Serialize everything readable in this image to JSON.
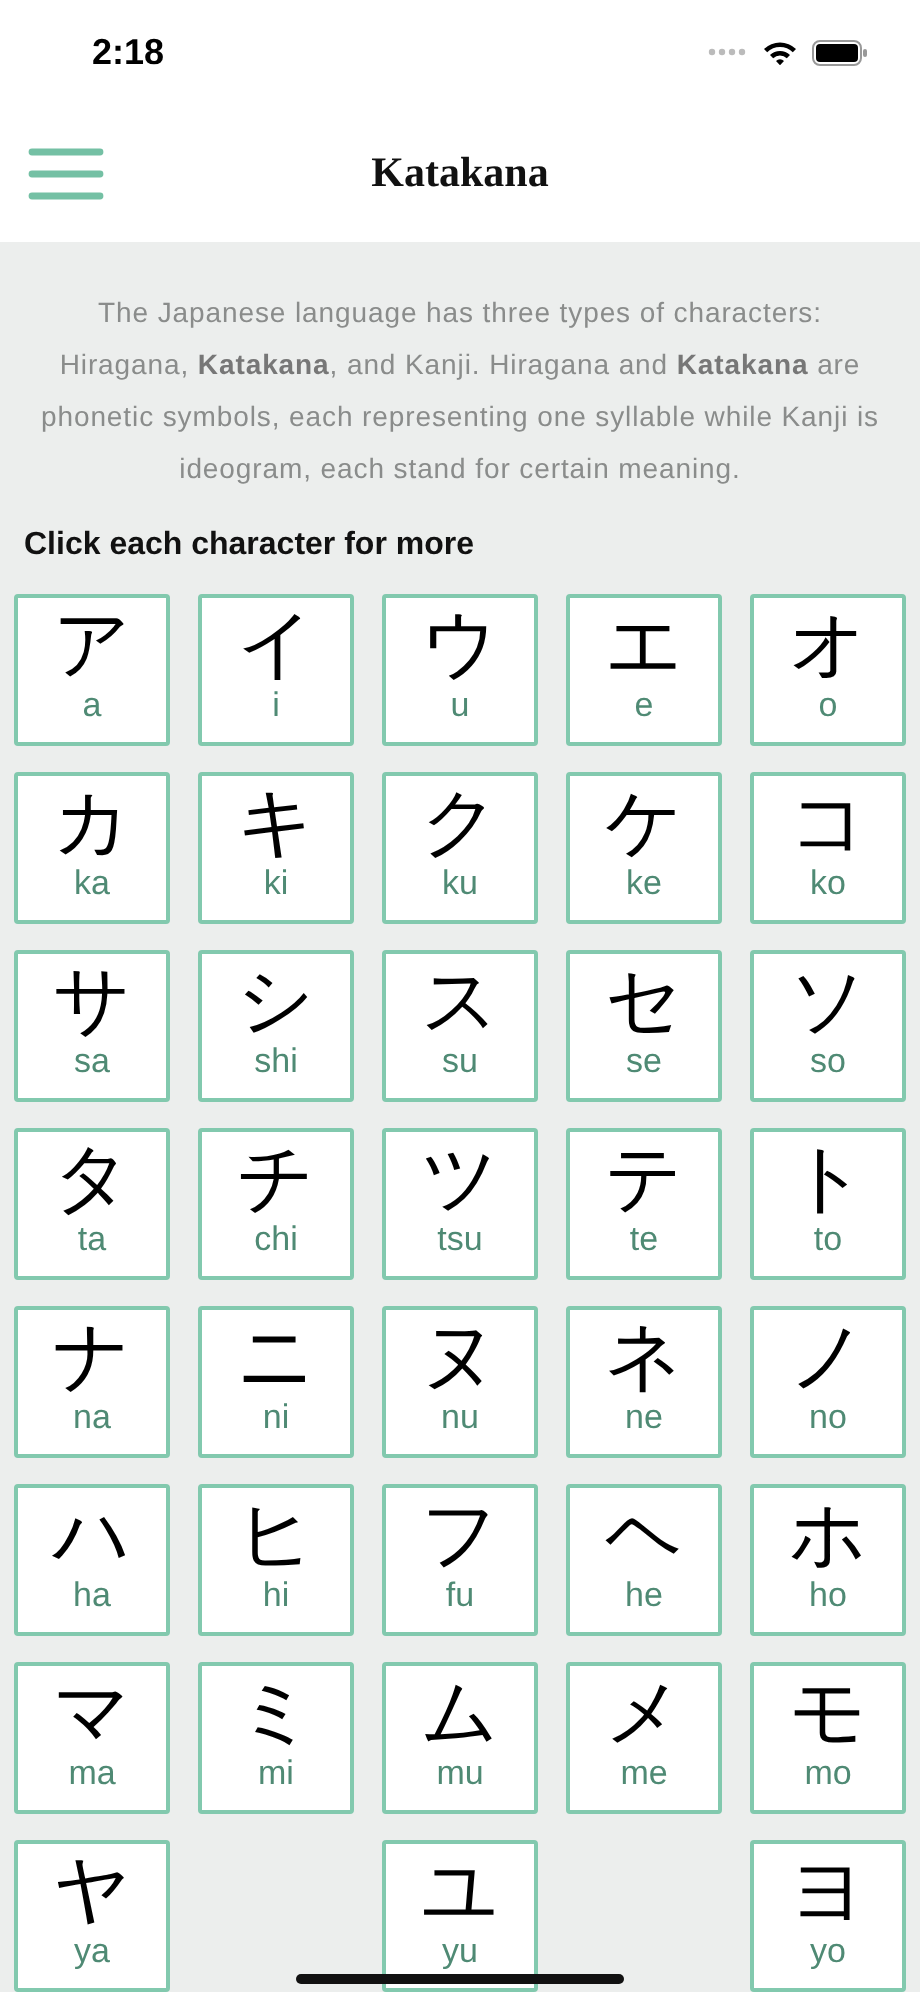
{
  "status_bar": {
    "time": "2:18"
  },
  "header": {
    "title": "Katakana"
  },
  "intro": "The Japanese language has three types of characters: Hiragana, **Katakana**, and Kanji. Hiragana and **Katakana** are phonetic symbols, each representing one syllable while Kanji is ideogram, each stand for certain meaning.",
  "instruction": "Click each character for more",
  "characters": [
    {
      "kind": "char",
      "kana": "ア",
      "romaji": "a"
    },
    {
      "kind": "char",
      "kana": "イ",
      "romaji": "i"
    },
    {
      "kind": "char",
      "kana": "ウ",
      "romaji": "u"
    },
    {
      "kind": "char",
      "kana": "エ",
      "romaji": "e"
    },
    {
      "kind": "char",
      "kana": "オ",
      "romaji": "o"
    },
    {
      "kind": "char",
      "kana": "カ",
      "romaji": "ka"
    },
    {
      "kind": "char",
      "kana": "キ",
      "romaji": "ki"
    },
    {
      "kind": "char",
      "kana": "ク",
      "romaji": "ku"
    },
    {
      "kind": "char",
      "kana": "ケ",
      "romaji": "ke"
    },
    {
      "kind": "char",
      "kana": "コ",
      "romaji": "ko"
    },
    {
      "kind": "char",
      "kana": "サ",
      "romaji": "sa"
    },
    {
      "kind": "char",
      "kana": "シ",
      "romaji": "shi"
    },
    {
      "kind": "char",
      "kana": "ス",
      "romaji": "su"
    },
    {
      "kind": "char",
      "kana": "セ",
      "romaji": "se"
    },
    {
      "kind": "char",
      "kana": "ソ",
      "romaji": "so"
    },
    {
      "kind": "char",
      "kana": "タ",
      "romaji": "ta"
    },
    {
      "kind": "char",
      "kana": "チ",
      "romaji": "chi"
    },
    {
      "kind": "char",
      "kana": "ツ",
      "romaji": "tsu"
    },
    {
      "kind": "char",
      "kana": "テ",
      "romaji": "te"
    },
    {
      "kind": "char",
      "kana": "ト",
      "romaji": "to"
    },
    {
      "kind": "char",
      "kana": "ナ",
      "romaji": "na"
    },
    {
      "kind": "char",
      "kana": "ニ",
      "romaji": "ni"
    },
    {
      "kind": "char",
      "kana": "ヌ",
      "romaji": "nu"
    },
    {
      "kind": "char",
      "kana": "ネ",
      "romaji": "ne"
    },
    {
      "kind": "char",
      "kana": "ノ",
      "romaji": "no"
    },
    {
      "kind": "char",
      "kana": "ハ",
      "romaji": "ha"
    },
    {
      "kind": "char",
      "kana": "ヒ",
      "romaji": "hi"
    },
    {
      "kind": "char",
      "kana": "フ",
      "romaji": "fu"
    },
    {
      "kind": "char",
      "kana": "ヘ",
      "romaji": "he"
    },
    {
      "kind": "char",
      "kana": "ホ",
      "romaji": "ho"
    },
    {
      "kind": "char",
      "kana": "マ",
      "romaji": "ma"
    },
    {
      "kind": "char",
      "kana": "ミ",
      "romaji": "mi"
    },
    {
      "kind": "char",
      "kana": "ム",
      "romaji": "mu"
    },
    {
      "kind": "char",
      "kana": "メ",
      "romaji": "me"
    },
    {
      "kind": "char",
      "kana": "モ",
      "romaji": "mo"
    },
    {
      "kind": "char",
      "kana": "ヤ",
      "romaji": "ya"
    },
    {
      "kind": "blank"
    },
    {
      "kind": "char",
      "kana": "ユ",
      "romaji": "yu"
    },
    {
      "kind": "blank"
    },
    {
      "kind": "char",
      "kana": "ヨ",
      "romaji": "yo"
    }
  ]
}
